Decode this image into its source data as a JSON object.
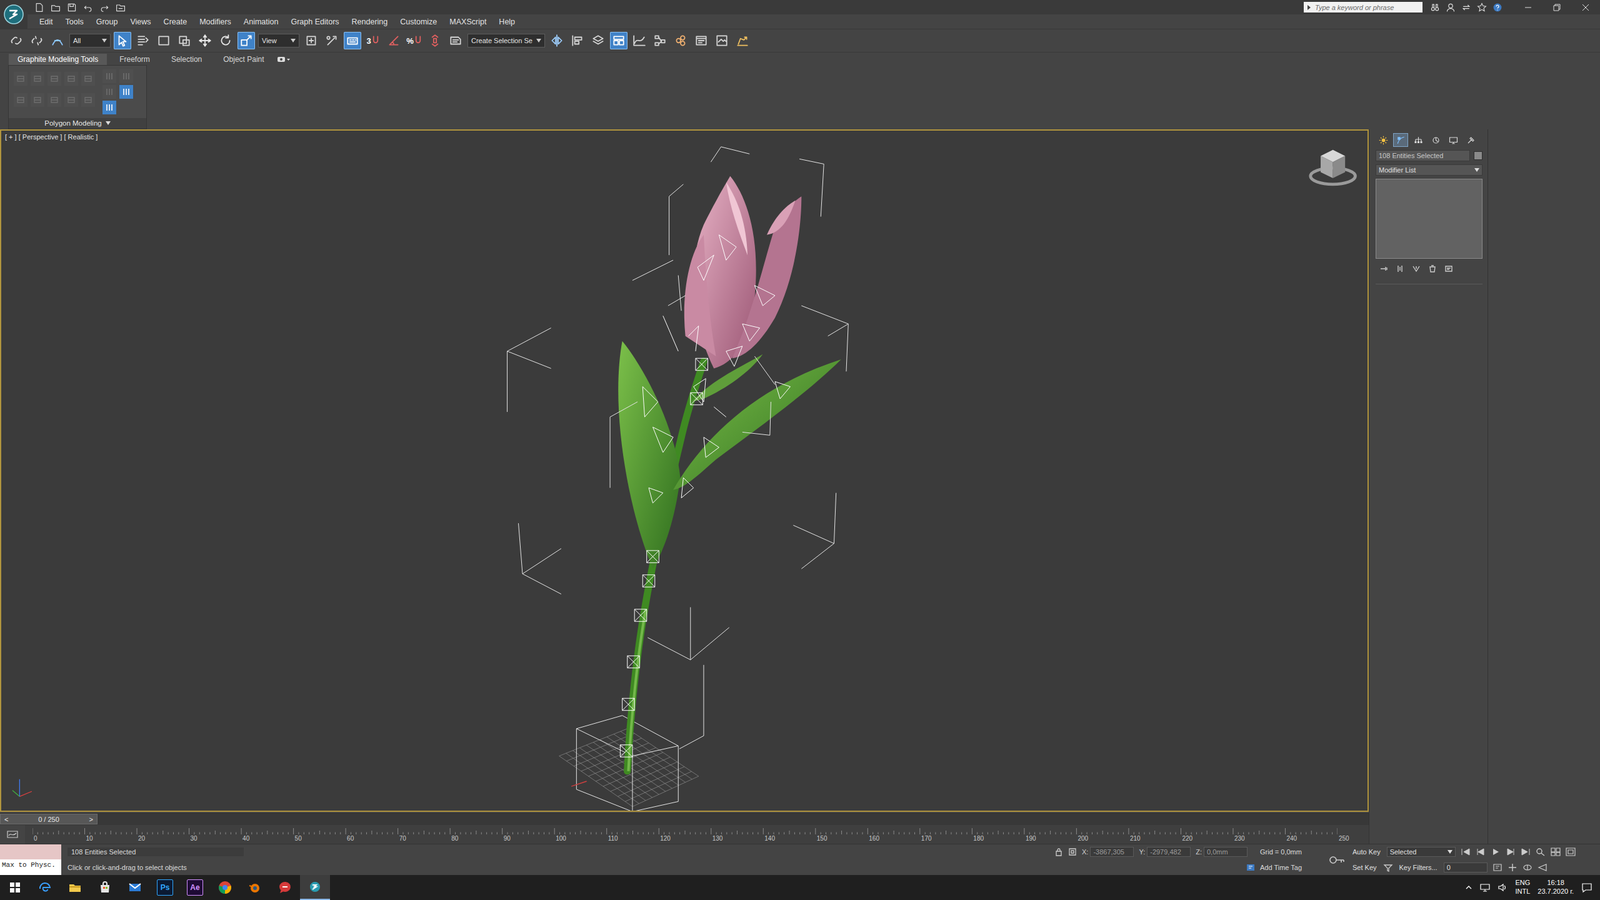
{
  "titlebar": {
    "search_placeholder": "Type a keyword or phrase"
  },
  "menu": [
    "Edit",
    "Tools",
    "Group",
    "Views",
    "Create",
    "Modifiers",
    "Animation",
    "Graph Editors",
    "Rendering",
    "Customize",
    "MAXScript",
    "Help"
  ],
  "toolbar": [
    {
      "kind": "link",
      "active": false
    },
    {
      "kind": "unlink",
      "active": false
    },
    {
      "kind": "bind",
      "active": false
    },
    {
      "kind": "dropdown",
      "value": "All"
    },
    {
      "kind": "select",
      "active": true
    },
    {
      "kind": "select-name",
      "active": false
    },
    {
      "kind": "rect-region",
      "active": false
    },
    {
      "kind": "crossing",
      "active": false
    },
    {
      "kind": "move",
      "active": false
    },
    {
      "kind": "rotate",
      "active": false
    },
    {
      "kind": "scale",
      "active": true
    },
    {
      "kind": "dropdown",
      "value": "View"
    },
    {
      "kind": "pivot",
      "active": false
    },
    {
      "kind": "manipulate",
      "active": false
    },
    {
      "kind": "override",
      "active": true
    },
    {
      "kind": "snap",
      "active": false,
      "glyph": "3"
    },
    {
      "kind": "angle-snap",
      "active": false
    },
    {
      "kind": "percent-snap",
      "active": false,
      "glyph": "%"
    },
    {
      "kind": "spinner-snap",
      "active": false
    },
    {
      "kind": "named-sel",
      "active": false
    },
    {
      "kind": "dropdown",
      "value": "Create Selection Se"
    },
    {
      "kind": "mirror",
      "active": false
    },
    {
      "kind": "align",
      "active": false
    },
    {
      "kind": "layers",
      "active": false
    },
    {
      "kind": "ribbon",
      "active": true
    },
    {
      "kind": "curve",
      "active": false
    },
    {
      "kind": "schematic",
      "active": false
    },
    {
      "kind": "material",
      "active": false
    },
    {
      "kind": "render-setup",
      "active": false
    },
    {
      "kind": "frame-window",
      "active": false
    },
    {
      "kind": "render",
      "active": false
    }
  ],
  "ribbon": {
    "tabs": [
      {
        "label": "Graphite Modeling Tools",
        "selected": true
      },
      {
        "label": "Freeform",
        "selected": false
      },
      {
        "label": "Selection",
        "selected": false
      },
      {
        "label": "Object Paint",
        "selected": false
      }
    ],
    "tools": [
      {
        "disabled": true
      },
      {
        "disabled": true
      },
      {
        "disabled": true
      },
      {
        "disabled": true
      },
      {
        "disabled": true
      },
      {
        "disabled": true
      },
      {
        "disabled": true
      },
      {
        "disabled": true
      },
      {
        "disabled": true
      },
      {
        "disabled": true
      }
    ],
    "side_tools": [
      {
        "disabled": true
      },
      {
        "disabled": true
      },
      {
        "disabled": false
      },
      {
        "disabled": true
      },
      {
        "disabled": false
      }
    ],
    "panel_label": "Polygon Modeling"
  },
  "viewport": {
    "label": "[ + ] [ Perspective ] [ Realistic ]",
    "active": true
  },
  "command_panel": {
    "tabs": [
      {
        "kind": "create",
        "selected": false
      },
      {
        "kind": "modify",
        "selected": true
      },
      {
        "kind": "hierarchy",
        "selected": false
      },
      {
        "kind": "motion",
        "selected": false
      },
      {
        "kind": "display",
        "selected": false
      },
      {
        "kind": "utilities",
        "selected": false
      }
    ],
    "object_name": "108 Entities Selected",
    "modifier_list": "Modifier List"
  },
  "time_slider": {
    "prev": "<",
    "label": "0 / 250",
    "next": ">",
    "level": 0
  },
  "trackbar": {
    "ticks": [
      "0",
      "10",
      "20",
      "30",
      "40",
      "50",
      "60",
      "70",
      "80",
      "90",
      "100",
      "110",
      "120",
      "130",
      "140",
      "150",
      "160",
      "170",
      "180",
      "190",
      "200",
      "210",
      "220",
      "230",
      "240",
      "250"
    ]
  },
  "status_bar": {
    "listener": "Max to Physc.",
    "selection": "108 Entities Selected",
    "prompt": "Click or click-and-drag to select objects",
    "coords": [
      {
        "axis": "X:",
        "value": "-3867,305"
      },
      {
        "axis": "Y:",
        "value": "-2979,482"
      },
      {
        "axis": "Z:",
        "value": "0,0mm"
      }
    ],
    "grid": "Grid = 0,0mm",
    "add_time_tag": "Add Time Tag",
    "auto_key": "Auto Key",
    "key_mode": "Selected",
    "set_key": "Set Key",
    "key_filters": "Key Filters...",
    "frame": "0"
  },
  "taskbar": {
    "apps": [
      {
        "kind": "edge",
        "selected": false
      },
      {
        "kind": "explorer",
        "selected": false
      },
      {
        "kind": "store",
        "selected": false
      },
      {
        "kind": "mail",
        "selected": false
      },
      {
        "kind": "photoshop",
        "label": "Ps",
        "selected": false
      },
      {
        "kind": "aftereffects",
        "label": "Ae",
        "selected": false
      },
      {
        "kind": "chrome",
        "selected": false
      },
      {
        "kind": "blender",
        "selected": false
      },
      {
        "kind": "chat",
        "selected": false
      },
      {
        "kind": "max",
        "selected": true
      }
    ],
    "tray": {
      "lang": "ENG",
      "layout": "INTL",
      "time": "16:18",
      "date": "23.7.2020 г."
    }
  }
}
